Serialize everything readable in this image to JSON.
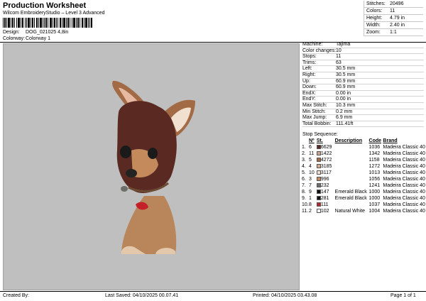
{
  "header": {
    "title": "Production Worksheet",
    "subtitle": "Wilcom EmbroideryStudio – Level 3 Advanced",
    "design_label": "Design:",
    "design_value": "DOG_021025 4,8in",
    "colorway_label": "Colorway:",
    "colorway_value": "Colorway 1"
  },
  "summary": {
    "stitches_label": "Stitches:",
    "stitches_value": "20496",
    "colors_label": "Colors:",
    "colors_value": "11",
    "height_label": "Height:",
    "height_value": "4.79 in",
    "width_label": "Width:",
    "width_value": "2.40 in",
    "zoom_label": "Zoom:",
    "zoom_value": "1:1"
  },
  "specs": {
    "machine_label": "Machine:",
    "machine_value": "Tajima",
    "color_changes_label": "Color changes:",
    "color_changes_value": "10",
    "stops_label": "Stops:",
    "stops_value": "11",
    "trims_label": "Trims:",
    "trims_value": "63",
    "left_label": "Left:",
    "left_value": "30.5 mm",
    "right_label": "Right:",
    "right_value": "30.5 mm",
    "up_label": "Up:",
    "up_value": "60.9 mm",
    "down_label": "Down:",
    "down_value": "60.9 mm",
    "endx_label": "EndX:",
    "endx_value": "0.00 in",
    "endy_label": "EndY:",
    "endy_value": "0.00 in",
    "max_stitch_label": "Max Stitch:",
    "max_stitch_value": "10.3 mm",
    "min_stitch_label": "Min Stitch:",
    "min_stitch_value": "0.2 mm",
    "max_jump_label": "Max Jump:",
    "max_jump_value": "6.9 mm",
    "total_bobbin_label": "Total Bobbin:",
    "total_bobbin_value": "111.41ft"
  },
  "stop_sequence": {
    "title": "Stop Sequence:",
    "columns": [
      "Nº",
      "St.",
      "Description",
      "Code",
      "Brand"
    ],
    "rows": [
      {
        "idx": "1.",
        "n": "6",
        "st": "6629",
        "desc": "",
        "code": "1036",
        "brand": "Madeira Classic 40",
        "color": "#5a2a22"
      },
      {
        "idx": "2.",
        "n": "11",
        "st": "1422",
        "desc": "",
        "code": "1342",
        "brand": "Madeira Classic 40",
        "color": "#c9a48e"
      },
      {
        "idx": "3.",
        "n": "5",
        "st": "4272",
        "desc": "",
        "code": "1158",
        "brand": "Madeira Classic 40",
        "color": "#a36a46"
      },
      {
        "idx": "4.",
        "n": "4",
        "st": "3185",
        "desc": "",
        "code": "1272",
        "brand": "Madeira Classic 40",
        "color": "#d8a98a"
      },
      {
        "idx": "5.",
        "n": "10",
        "st": "3117",
        "desc": "",
        "code": "1013",
        "brand": "Madeira Classic 40",
        "color": "#f1dfd0"
      },
      {
        "idx": "6.",
        "n": "3",
        "st": "996",
        "desc": "",
        "code": "1056",
        "brand": "Madeira Classic 40",
        "color": "#c48a5c"
      },
      {
        "idx": "7.",
        "n": "7",
        "st": "232",
        "desc": "",
        "code": "1241",
        "brand": "Madeira Classic 40",
        "color": "#6d6d69"
      },
      {
        "idx": "8.",
        "n": "9",
        "st": "147",
        "desc": "Emerald Black",
        "code": "1000",
        "brand": "Madeira Classic 40",
        "color": "#111111"
      },
      {
        "idx": "9.",
        "n": "1",
        "st": "281",
        "desc": "Emerald Black",
        "code": "1000",
        "brand": "Madeira Classic 40",
        "color": "#111111"
      },
      {
        "idx": "10.",
        "n": "8",
        "st": "111",
        "desc": "",
        "code": "1037",
        "brand": "Madeira Classic 40",
        "color": "#c4202a"
      },
      {
        "idx": "11.",
        "n": "2",
        "st": "102",
        "desc": "Natural White",
        "code": "1004",
        "brand": "Madeira Classic 40",
        "color": "#ffffff"
      }
    ]
  },
  "footer": {
    "created_by": "Created By:",
    "last_saved": "Last Saved: 04/10/2025 00.07.41",
    "printed": "Printed: 04/10/2025 03.43.08",
    "page": "Page 1 of 1"
  }
}
